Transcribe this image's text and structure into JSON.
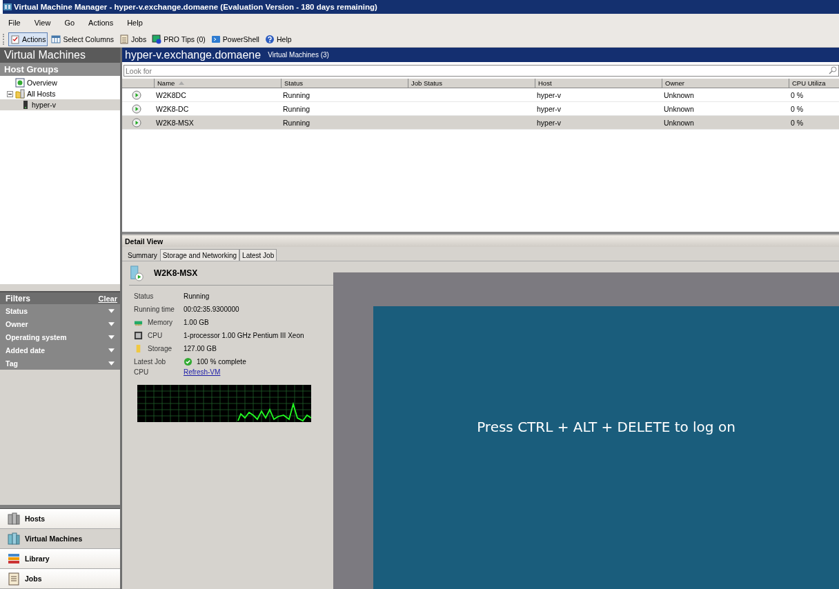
{
  "window": {
    "title": "Virtual Machine Manager - hyper-v.exchange.domaene (Evaluation Version - 180 days remaining)"
  },
  "menu": [
    "File",
    "View",
    "Go",
    "Actions",
    "Help"
  ],
  "toolbar": [
    {
      "label": "Actions",
      "kind": "actions",
      "selected": true
    },
    {
      "label": "Select Columns",
      "kind": "columns",
      "selected": false
    },
    {
      "label": "Jobs",
      "kind": "jobs",
      "selected": false
    },
    {
      "label": "PRO Tips (0)",
      "kind": "tips",
      "selected": false
    },
    {
      "label": "PowerShell",
      "kind": "shell",
      "selected": false
    },
    {
      "label": "Help",
      "kind": "help",
      "selected": false
    }
  ],
  "sidebar": {
    "title": "Virtual Machines",
    "section": "Host Groups",
    "tree": [
      {
        "label": "Overview",
        "kind": "overview",
        "selected": false
      },
      {
        "label": "All Hosts",
        "kind": "folder",
        "selected": false,
        "expanded": true,
        "children": [
          {
            "label": "hyper-v",
            "kind": "server",
            "selected": true
          }
        ]
      }
    ],
    "filters": {
      "title": "Filters",
      "clear": "Clear",
      "items": [
        "Status",
        "Owner",
        "Operating system",
        "Added date",
        "Tag"
      ]
    },
    "nav": [
      {
        "label": "Hosts",
        "kind": "hosts",
        "selected": false
      },
      {
        "label": "Virtual Machines",
        "kind": "vms",
        "selected": true
      },
      {
        "label": "Library",
        "kind": "library",
        "selected": false
      },
      {
        "label": "Jobs",
        "kind": "jobs",
        "selected": false
      }
    ]
  },
  "main": {
    "title": "hyper-v.exchange.domaene",
    "subtitle": "Virtual Machines (3)",
    "search": {
      "placeholder": "Look for"
    },
    "table": {
      "columns": [
        "Name",
        "Status",
        "Job Status",
        "Host",
        "Owner",
        "CPU Utiliza"
      ],
      "rows": [
        {
          "cells": [
            "W2K8DC",
            "Running",
            "",
            "hyper-v",
            "Unknown",
            "0 %"
          ],
          "selected": false
        },
        {
          "cells": [
            "W2K8-DC",
            "Running",
            "",
            "hyper-v",
            "Unknown",
            "0 %"
          ],
          "selected": false
        },
        {
          "cells": [
            "W2K8-MSX",
            "Running",
            "",
            "hyper-v",
            "Unknown",
            "0 %"
          ],
          "selected": true
        }
      ]
    }
  },
  "detail": {
    "title": "Detail View",
    "tabs": [
      {
        "label": "Summary",
        "selected": true
      },
      {
        "label": "Storage and Networking",
        "selected": false
      },
      {
        "label": "Latest Job",
        "selected": false
      }
    ],
    "vm_name": "W2K8-MSX",
    "fields": [
      {
        "label": "Status",
        "value": "Running",
        "kind": "plain"
      },
      {
        "label": "Running time",
        "value": "00:02:35.9300000",
        "kind": "plain"
      },
      {
        "label": "Memory",
        "value": "1.00 GB",
        "kind": "memory"
      },
      {
        "label": "CPU",
        "value": "1-processor 1.00 GHz Pentium III Xeon",
        "kind": "cpu"
      },
      {
        "label": "Storage",
        "value": "127.00 GB",
        "kind": "storage"
      }
    ],
    "latest_job": {
      "label": "Latest Job",
      "value": "100 % complete",
      "link": "Refresh-VM"
    },
    "cpu_label": "CPU",
    "console_text": "Press CTRL + ALT + DELETE to log on"
  }
}
